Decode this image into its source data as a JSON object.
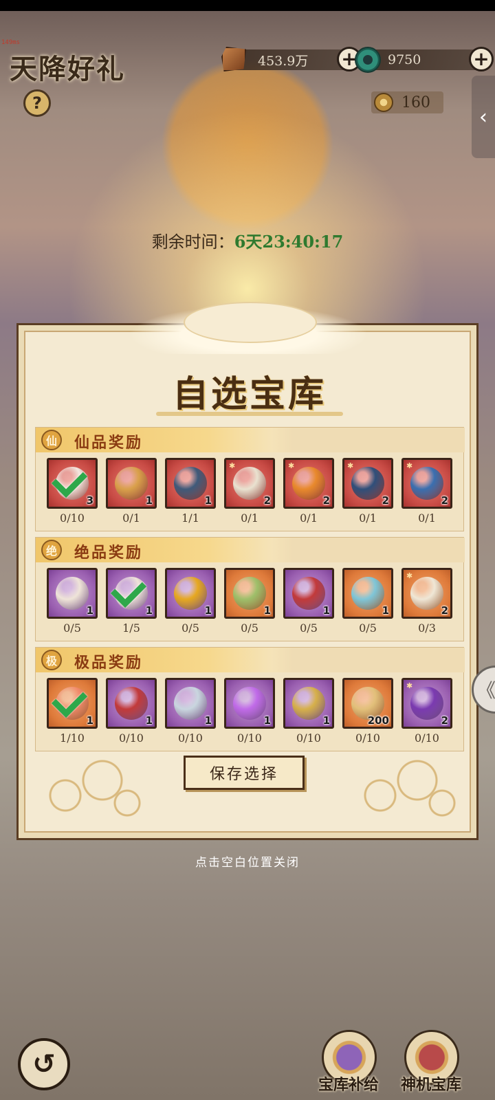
{
  "status": {
    "fps_text": "149ms"
  },
  "header": {
    "title": "天降好礼",
    "help_label": "?",
    "currencies": [
      {
        "icon": "ore-icon",
        "value": "453.9万",
        "add_label": "+"
      },
      {
        "icon": "jade-icon",
        "value": "9750",
        "add_label": "+"
      }
    ],
    "coins": {
      "icon": "coin-icon",
      "value": "160"
    },
    "side_tab_label": "‹"
  },
  "timer": {
    "label": "剩余时间：",
    "value": "6天23:40:17"
  },
  "panel": {
    "title": "自选宝库",
    "save_label": "保存选择",
    "tiers": [
      {
        "badge": "仙",
        "title": "仙品奖励",
        "items": [
          {
            "quality": "red",
            "art": "talisman-scroll-icon",
            "qty": "3",
            "progress": "0/10",
            "selected": true,
            "star": false
          },
          {
            "quality": "red",
            "art": "treasure-bag-icon",
            "qty": "1",
            "progress": "0/1",
            "selected": false,
            "star": false
          },
          {
            "quality": "red",
            "art": "dragon-relic-icon",
            "qty": "1",
            "progress": "1/1",
            "selected": false,
            "star": false
          },
          {
            "quality": "red",
            "art": "curved-blade-icon",
            "qty": "2",
            "progress": "0/1",
            "selected": false,
            "star": true
          },
          {
            "quality": "red",
            "art": "flame-gauntlet-icon",
            "qty": "2",
            "progress": "0/1",
            "selected": false,
            "star": true
          },
          {
            "quality": "red",
            "art": "jade-lantern-icon",
            "qty": "2",
            "progress": "0/1",
            "selected": false,
            "star": true
          },
          {
            "quality": "red",
            "art": "flute-icon",
            "qty": "2",
            "progress": "0/1",
            "selected": false,
            "star": true
          }
        ]
      },
      {
        "badge": "绝",
        "title": "绝品奖励",
        "items": [
          {
            "quality": "purple",
            "art": "silk-pouch-icon",
            "qty": "1",
            "progress": "0/5",
            "selected": false,
            "star": false
          },
          {
            "quality": "purple",
            "art": "silk-pouch-icon",
            "qty": "1",
            "progress": "1/5",
            "selected": true,
            "star": false
          },
          {
            "quality": "purple",
            "art": "golden-orb-icon",
            "qty": "1",
            "progress": "0/5",
            "selected": false,
            "star": false
          },
          {
            "quality": "orange",
            "art": "jade-bundle-icon",
            "qty": "1",
            "progress": "0/5",
            "selected": false,
            "star": false
          },
          {
            "quality": "purple",
            "art": "red-pouch-icon",
            "qty": "1",
            "progress": "0/5",
            "selected": false,
            "star": false
          },
          {
            "quality": "orange",
            "art": "porcelain-vase-icon",
            "qty": "1",
            "progress": "0/5",
            "selected": false,
            "star": false
          },
          {
            "quality": "orange",
            "art": "brush-icon",
            "qty": "2",
            "progress": "0/3",
            "selected": false,
            "star": true
          }
        ]
      },
      {
        "badge": "极",
        "title": "极品奖励",
        "items": [
          {
            "quality": "orange",
            "art": "peach-icon",
            "qty": "1",
            "progress": "1/10",
            "selected": true,
            "star": false
          },
          {
            "quality": "purple",
            "art": "red-pouch-icon",
            "qty": "1",
            "progress": "0/10",
            "selected": false,
            "star": false
          },
          {
            "quality": "purple",
            "art": "silver-pouch-icon",
            "qty": "1",
            "progress": "0/10",
            "selected": false,
            "star": false
          },
          {
            "quality": "purple",
            "art": "violet-orb-icon",
            "qty": "1",
            "progress": "0/10",
            "selected": false,
            "star": false
          },
          {
            "quality": "purple",
            "art": "golden-bundle-icon",
            "qty": "1",
            "progress": "0/10",
            "selected": false,
            "star": false
          },
          {
            "quality": "orange",
            "art": "scroll-icon",
            "qty": "200",
            "progress": "0/10",
            "selected": false,
            "star": false
          },
          {
            "quality": "purple",
            "art": "purple-flower-icon",
            "qty": "2",
            "progress": "0/10",
            "selected": false,
            "star": true
          }
        ]
      }
    ]
  },
  "close_hint": "点击空白位置关闭",
  "side_handle_label": "《",
  "bottom": {
    "back_label": "↺",
    "entries": [
      {
        "icon": "gift-box-icon",
        "label": "宝库补给"
      },
      {
        "icon": "treasure-chest-icon",
        "label": "神机宝库"
      }
    ]
  }
}
